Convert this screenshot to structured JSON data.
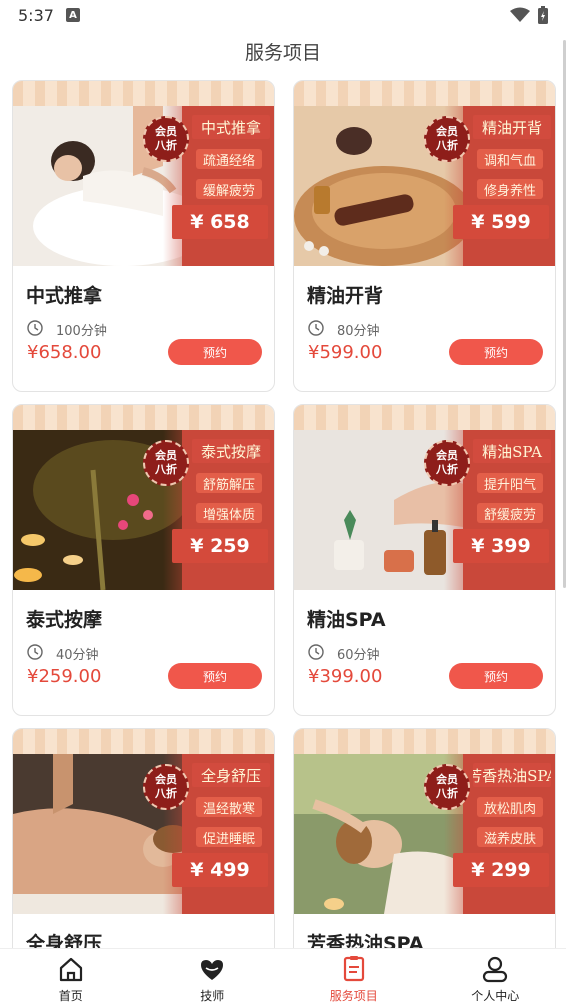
{
  "status_bar": {
    "time": "5:37",
    "notification_icon": "A"
  },
  "header": {
    "title": "服务项目"
  },
  "services": [
    {
      "name": "中式推拿",
      "badge_line1": "会员",
      "badge_line2": "八折",
      "banner_title": "中式推拿",
      "tag1": "疏通经络",
      "tag2": "缓解疲劳",
      "banner_price": "¥ 658",
      "duration": "100分钟",
      "price": "¥658.00",
      "book_label": "预约",
      "photo_icon": "massage-photo"
    },
    {
      "name": "精油开背",
      "badge_line1": "会员",
      "badge_line2": "八折",
      "banner_title": "精油开背",
      "tag1": "调和气血",
      "tag2": "修身养性",
      "banner_price": "¥ 599",
      "duration": "80分钟",
      "price": "¥599.00",
      "book_label": "预约",
      "photo_icon": "essential-oil-photo"
    },
    {
      "name": "泰式按摩",
      "badge_line1": "会员",
      "badge_line2": "八折",
      "banner_title": "泰式按摩",
      "tag1": "舒筋解压",
      "tag2": "增强体质",
      "banner_price": "¥ 259",
      "duration": "40分钟",
      "price": "¥259.00",
      "book_label": "预约",
      "photo_icon": "candles-photo"
    },
    {
      "name": "精油SPA",
      "badge_line1": "会员",
      "badge_line2": "八折",
      "banner_title": "精油SPA",
      "tag1": "提升阳气",
      "tag2": "舒缓疲劳",
      "banner_price": "¥ 399",
      "duration": "60分钟",
      "price": "¥399.00",
      "book_label": "预约",
      "photo_icon": "spa-products-photo"
    },
    {
      "name": "全身舒压",
      "badge_line1": "会员",
      "badge_line2": "八折",
      "banner_title": "全身舒压",
      "tag1": "温经散寒",
      "tag2": "促进睡眠",
      "banner_price": "¥ 499",
      "duration": "",
      "price": "",
      "book_label": "",
      "photo_icon": "back-massage-photo"
    },
    {
      "name": "芳香热油SPA",
      "badge_line1": "会员",
      "badge_line2": "八折",
      "banner_title": "芳香热油SPA",
      "tag1": "放松肌肉",
      "tag2": "滋养皮肤",
      "banner_price": "¥ 299",
      "duration": "",
      "price": "",
      "book_label": "",
      "photo_icon": "head-massage-photo"
    }
  ],
  "bottom_nav": [
    {
      "label": "首页",
      "icon": "home-icon",
      "active": false
    },
    {
      "label": "技师",
      "icon": "technician-icon",
      "active": false
    },
    {
      "label": "服务项目",
      "icon": "service-list-icon",
      "active": true
    },
    {
      "label": "个人中心",
      "icon": "profile-icon",
      "active": false
    }
  ],
  "colors": {
    "accent": "#e4493b",
    "button": "#f0574b",
    "banner_red": "#c9483a"
  }
}
